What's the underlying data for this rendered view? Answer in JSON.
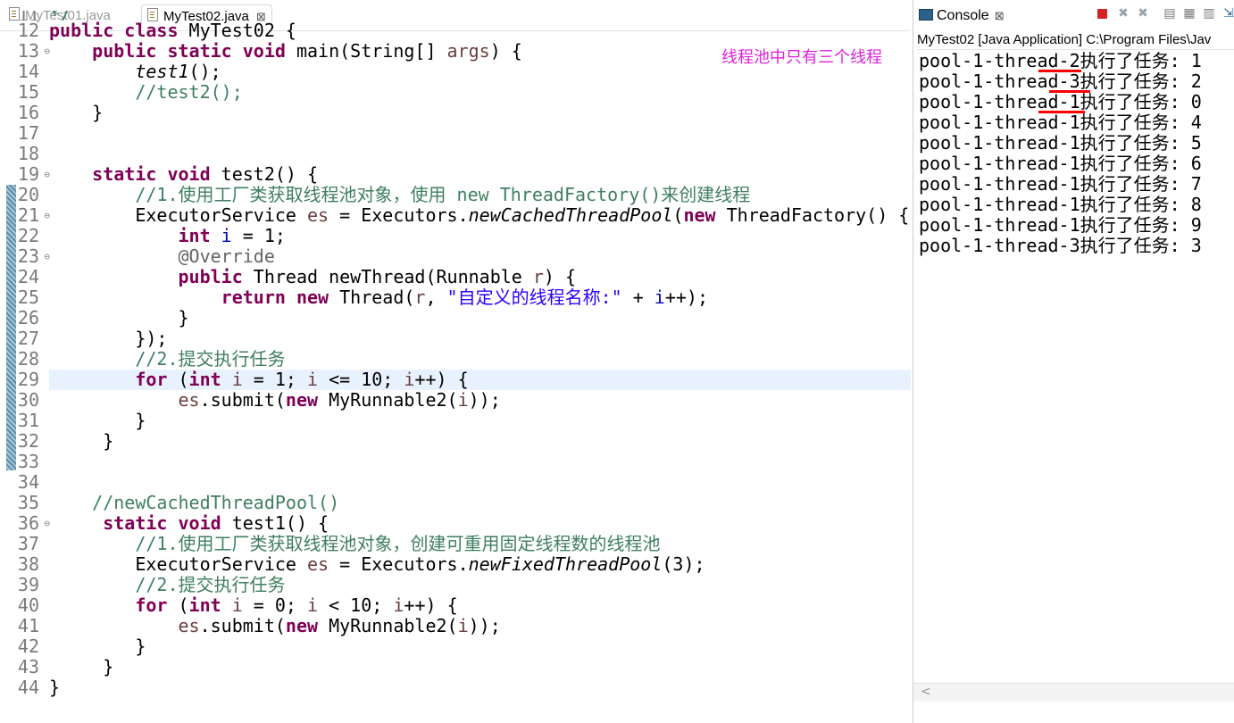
{
  "editor": {
    "tabs": [
      {
        "label": "MyTest01.java"
      },
      {
        "label": "MyTest02.java",
        "close": "⊠"
      }
    ],
    "top_partial": "*/",
    "line_numbers": [
      "11",
      "12",
      "13",
      "14",
      "15",
      "16",
      "17",
      "18",
      "19",
      "20",
      "21",
      "22",
      "23",
      "24",
      "25",
      "26",
      "27",
      "28",
      "29",
      "30",
      "31",
      "32",
      "33",
      "34",
      "35",
      "36",
      "37",
      "38",
      "39",
      "40",
      "41",
      "42",
      "43",
      "44"
    ],
    "annotation": "线程池中只有三个线程",
    "code": {
      "l12": {
        "kw1": "public class",
        "rest": " MyTest02 {"
      },
      "l13": {
        "kw1": "public static void",
        "rest1": " main(String[] ",
        "par": "args",
        "rest2": ") {"
      },
      "l14": {
        "call": "test1",
        "rest": "();"
      },
      "l15": {
        "comment": "//test2();"
      },
      "l16": {
        "text": "}"
      },
      "l19": {
        "kw1": "static void",
        "rest": " test2() {"
      },
      "l20": {
        "comment": "//1.使用工厂类获取线程池对象，使用 new ThreadFactory()来创建线程"
      },
      "l21": {
        "t1": "ExecutorService ",
        "var": "es",
        "t2": " = Executors.",
        "call": "newCachedThreadPool",
        "t3": "(",
        "kw": "new",
        "t4": " ThreadFactory() {"
      },
      "l22": {
        "kw": "int",
        "t1": " ",
        "var": "i",
        "t2": " = 1;"
      },
      "l23": {
        "ann": "@Override"
      },
      "l24": {
        "kw": "public",
        "t1": " Thread newThread(Runnable ",
        "par": "r",
        "t2": ") {"
      },
      "l25": {
        "kw": "return new",
        "t1": " Thread(",
        "par": "r",
        "t2": ", ",
        "str": "\"自定义的线程名称:\"",
        "t3": " + ",
        "var": "i",
        "t4": "++);"
      },
      "l26": {
        "text": "}"
      },
      "l27": {
        "text": "});"
      },
      "l28": {
        "comment": "//2.提交执行任务"
      },
      "l29": {
        "kw": "for",
        "t1": " (",
        "kw2": "int",
        "t2": " ",
        "var": "i",
        "t3": " = 1; ",
        "var2": "i",
        "t4": " <= 10; ",
        "var3": "i",
        "t5": "++) {"
      },
      "l30": {
        "var": "es",
        "t1": ".submit(",
        "kw": "new",
        "t2": " MyRunnable2(",
        "var2": "i",
        "t3": "));"
      },
      "l31": {
        "text": "}"
      },
      "l32": {
        "text": "}"
      },
      "l35": {
        "comment": "//newCachedThreadPool()"
      },
      "l36": {
        "kw1": "static void",
        "rest": " test1() {"
      },
      "l37": {
        "comment": "//1.使用工厂类获取线程池对象，创建可重用固定线程数的线程池"
      },
      "l38": {
        "t1": "ExecutorService ",
        "var": "es",
        "t2": " = Executors.",
        "call": "newFixedThreadPool",
        "t3": "(3);"
      },
      "l39": {
        "comment": "//2.提交执行任务"
      },
      "l40": {
        "kw": "for",
        "t1": " (",
        "kw2": "int",
        "t2": " ",
        "var": "i",
        "t3": " = 0; ",
        "var2": "i",
        "t4": " < 10; ",
        "var3": "i",
        "t5": "++) {"
      },
      "l41": {
        "var": "es",
        "t1": ".submit(",
        "kw": "new",
        "t2": " MyRunnable2(",
        "var2": "i",
        "t3": "));"
      },
      "l42": {
        "text": "}"
      },
      "l43": {
        "text": "}"
      },
      "l44": {
        "text": "}"
      }
    }
  },
  "console": {
    "tab_label": "Console",
    "tab_close": "⊠",
    "path": "MyTest02 [Java Application] C:\\Program Files\\Jav",
    "lines": [
      "pool-1-thread-2执行了任务: 1",
      "pool-1-thread-3执行了任务: 2",
      "pool-1-thread-1执行了任务: 0",
      "pool-1-thread-1执行了任务: 4",
      "pool-1-thread-1执行了任务: 5",
      "pool-1-thread-1执行了任务: 6",
      "pool-1-thread-1执行了任务: 7",
      "pool-1-thread-1执行了任务: 8",
      "pool-1-thread-1执行了任务: 9",
      "pool-1-thread-3执行了任务: 3"
    ],
    "scroll_left": "<"
  },
  "colors": {
    "keyword": "#7f0055",
    "comment": "#3f7f5f",
    "string": "#2a00ff",
    "field": "#0000c0",
    "annotation_note": "#e020e0",
    "underline": "#ff0000",
    "highlight_line": "#e8f2fe"
  },
  "icons": [
    "file-icon",
    "console-icon",
    "terminate-icon",
    "remove-launch-icon",
    "remove-all-icon",
    "scroll-lock-icon",
    "pin-console-icon",
    "word-wrap-icon",
    "display-console-icon"
  ]
}
